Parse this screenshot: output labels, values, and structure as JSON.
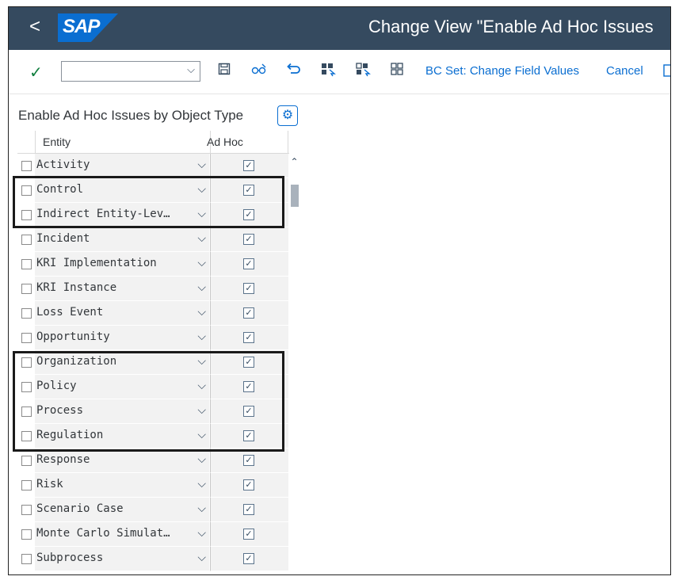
{
  "shell": {
    "back_glyph": "<",
    "logo_text": "SAP",
    "title": "Change View \"Enable Ad Hoc Issues"
  },
  "toolbar": {
    "bc_set_label": "BC Set: Change Field Values",
    "cancel_label": "Cancel"
  },
  "panel": {
    "title": "Enable Ad Hoc Issues by Object Type",
    "columns": [
      "Entity",
      "Ad Hoc"
    ]
  },
  "rows": [
    {
      "entity": "Activity",
      "adhoc": true
    },
    {
      "entity": "Control",
      "adhoc": true
    },
    {
      "entity": "Indirect Entity-Lev…",
      "adhoc": true
    },
    {
      "entity": "Incident",
      "adhoc": true
    },
    {
      "entity": "KRI Implementation",
      "adhoc": true
    },
    {
      "entity": "KRI Instance",
      "adhoc": true
    },
    {
      "entity": "Loss Event",
      "adhoc": true
    },
    {
      "entity": "Opportunity",
      "adhoc": true
    },
    {
      "entity": "Organization",
      "adhoc": true
    },
    {
      "entity": "Policy",
      "adhoc": true
    },
    {
      "entity": "Process",
      "adhoc": true
    },
    {
      "entity": "Regulation",
      "adhoc": true
    },
    {
      "entity": "Response",
      "adhoc": true
    },
    {
      "entity": "Risk",
      "adhoc": true
    },
    {
      "entity": "Scenario Case",
      "adhoc": true
    },
    {
      "entity": "Monte Carlo Simulat…",
      "adhoc": true
    },
    {
      "entity": "Subprocess",
      "adhoc": true
    }
  ],
  "icons": {
    "confirm": "check-icon",
    "save": "save-icon",
    "toggle_edit": "glasses-icon",
    "undo": "undo-icon",
    "select_all": "select-all-icon",
    "select_block": "select-block-icon",
    "deselect_all": "deselect-all-icon",
    "settings": "gear-icon",
    "dropdown": "chevron-down-icon"
  },
  "colors": {
    "shell": "#354a5f",
    "accent": "#0a6ed1",
    "confirm": "#107e3e",
    "cell": "#f2f2f2"
  }
}
